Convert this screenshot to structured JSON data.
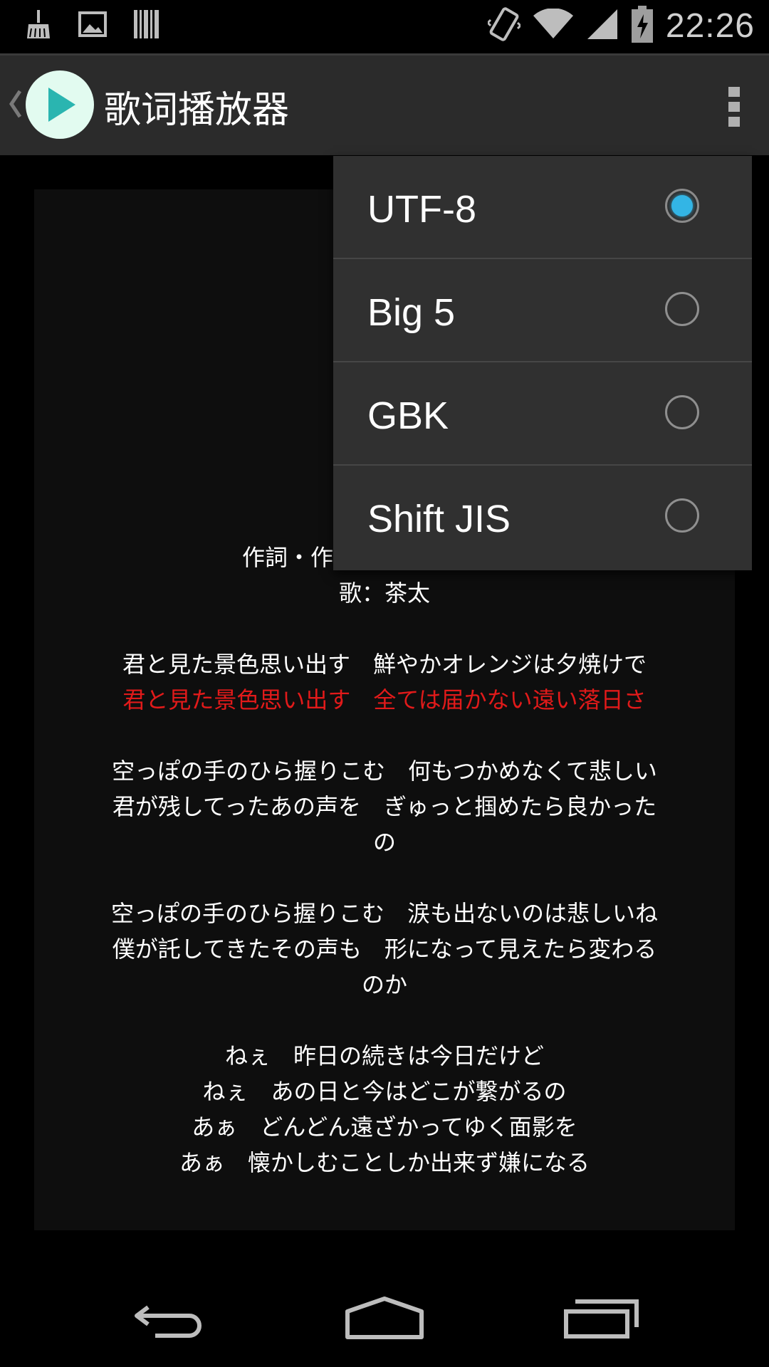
{
  "status_bar": {
    "time": "22:26",
    "left_icons": [
      "cleaner-icon",
      "image-icon",
      "barcode-icon"
    ],
    "right_icons": [
      "vibrate-icon",
      "wifi-icon",
      "signal-icon",
      "battery-charging-icon"
    ]
  },
  "action_bar": {
    "title": "歌词播放器",
    "icons": [
      "up-caret-icon",
      "play-icon",
      "overflow-menu-icon"
    ]
  },
  "lyrics": {
    "credits_partial": "作詞・作曲",
    "singer": "歌：茶太",
    "v1_l1": "君と見た景色思い出す　鮮やかオレンジは夕焼けで",
    "v1_l2": "君と見た景色思い出す　全ては届かない遠い落日さ",
    "v2_l1": "空っぽの手のひら握りこむ　何もつかめなくて悲しい",
    "v2_l2": "君が残してったあの声を　ぎゅっと掴めたら良かった",
    "v2_l3": "の",
    "v3_l1": "空っぽの手のひら握りこむ　涙も出ないのは悲しいね",
    "v3_l2": "僕が託してきたその声も　形になって見えたら変わる",
    "v3_l3": "のか",
    "v4_l1": "ねぇ　昨日の続きは今日だけど",
    "v4_l2": "ねぇ　あの日と今はどこが繋がるの",
    "v4_l3": "あぁ　どんどん遠ざかってゆく面影を",
    "v4_l4": "あぁ　懐かしむことしか出来ず嫌になる",
    "highlight_color": "#e11a1a"
  },
  "encoding_menu": {
    "selected": "UTF-8",
    "options": [
      {
        "label": "UTF-8",
        "checked": true
      },
      {
        "label": "Big 5",
        "checked": false
      },
      {
        "label": "GBK",
        "checked": false
      },
      {
        "label": "Shift JIS",
        "checked": false
      }
    ],
    "accent_color": "#33b5e5"
  },
  "nav_bar": {
    "icons": [
      "back-icon",
      "home-icon",
      "recents-icon"
    ]
  }
}
